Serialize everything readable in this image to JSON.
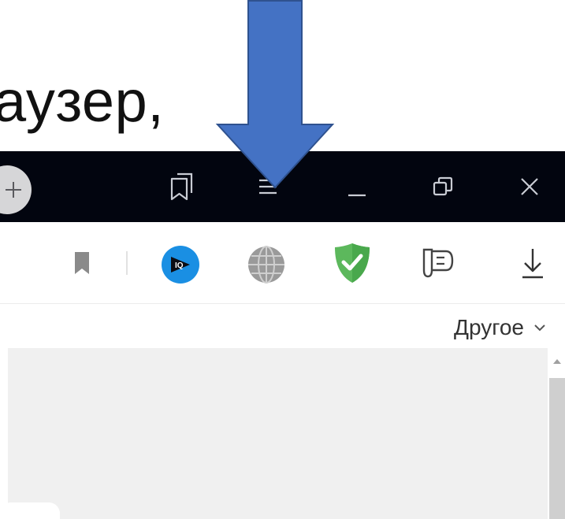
{
  "slide": {
    "caption": "аузер,"
  },
  "titlebar": {
    "new_tab_icon": "plus-icon",
    "buttons": [
      {
        "icon": "tab-cards-icon"
      },
      {
        "icon": "hamburger-menu-icon"
      },
      {
        "icon": "minimize-icon"
      },
      {
        "icon": "restore-icon"
      },
      {
        "icon": "close-icon"
      }
    ]
  },
  "toolbar": {
    "icons": [
      "bookmark-icon",
      "iq-extension-icon",
      "globe-vpn-icon",
      "adguard-shield-icon",
      "password-key-icon",
      "download-icon"
    ]
  },
  "bookmarks_bar": {
    "other_label": "Другое",
    "other_chevron": "⌄"
  },
  "annotation": {
    "arrow_color": "#4472c4",
    "arrow_border": "#2f528f"
  }
}
